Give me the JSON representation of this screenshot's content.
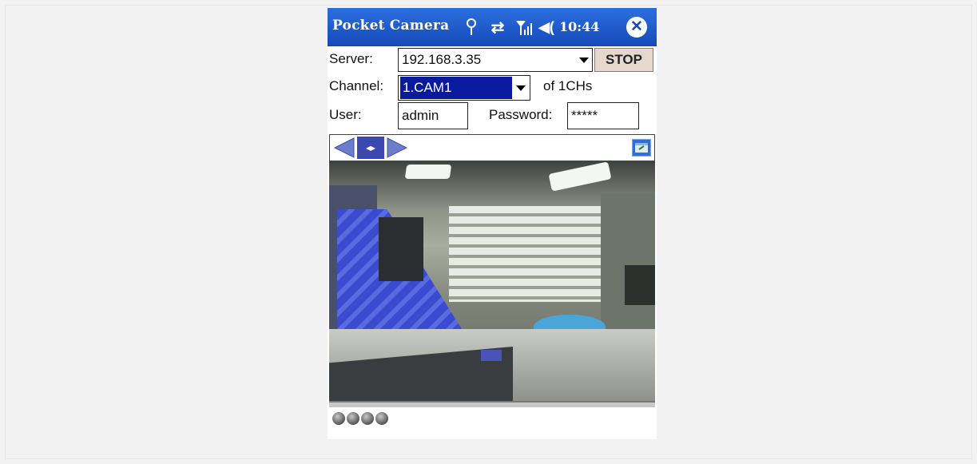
{
  "titlebar": {
    "title": "Pocket Camera",
    "time": "10:44",
    "icons": [
      "antenna-icon",
      "sync-icon",
      "signal-icon",
      "volume-icon",
      "close-icon"
    ],
    "close_glyph": "✕"
  },
  "form": {
    "server_label": "Server:",
    "server_value": "192.168.3.35",
    "stop_label": "STOP",
    "channel_label": "Channel:",
    "channel_value": "1.CAM1",
    "channel_count": "of 1CHs",
    "user_label": "User:",
    "user_value": "admin",
    "password_label": "Password:",
    "password_value": "*****"
  },
  "navbar": {
    "mid_glyph": "◂▸"
  },
  "colors": {
    "titlebar": "#1549b8",
    "selection": "#0a1a9e",
    "stop_button": "#e6d8cf"
  }
}
